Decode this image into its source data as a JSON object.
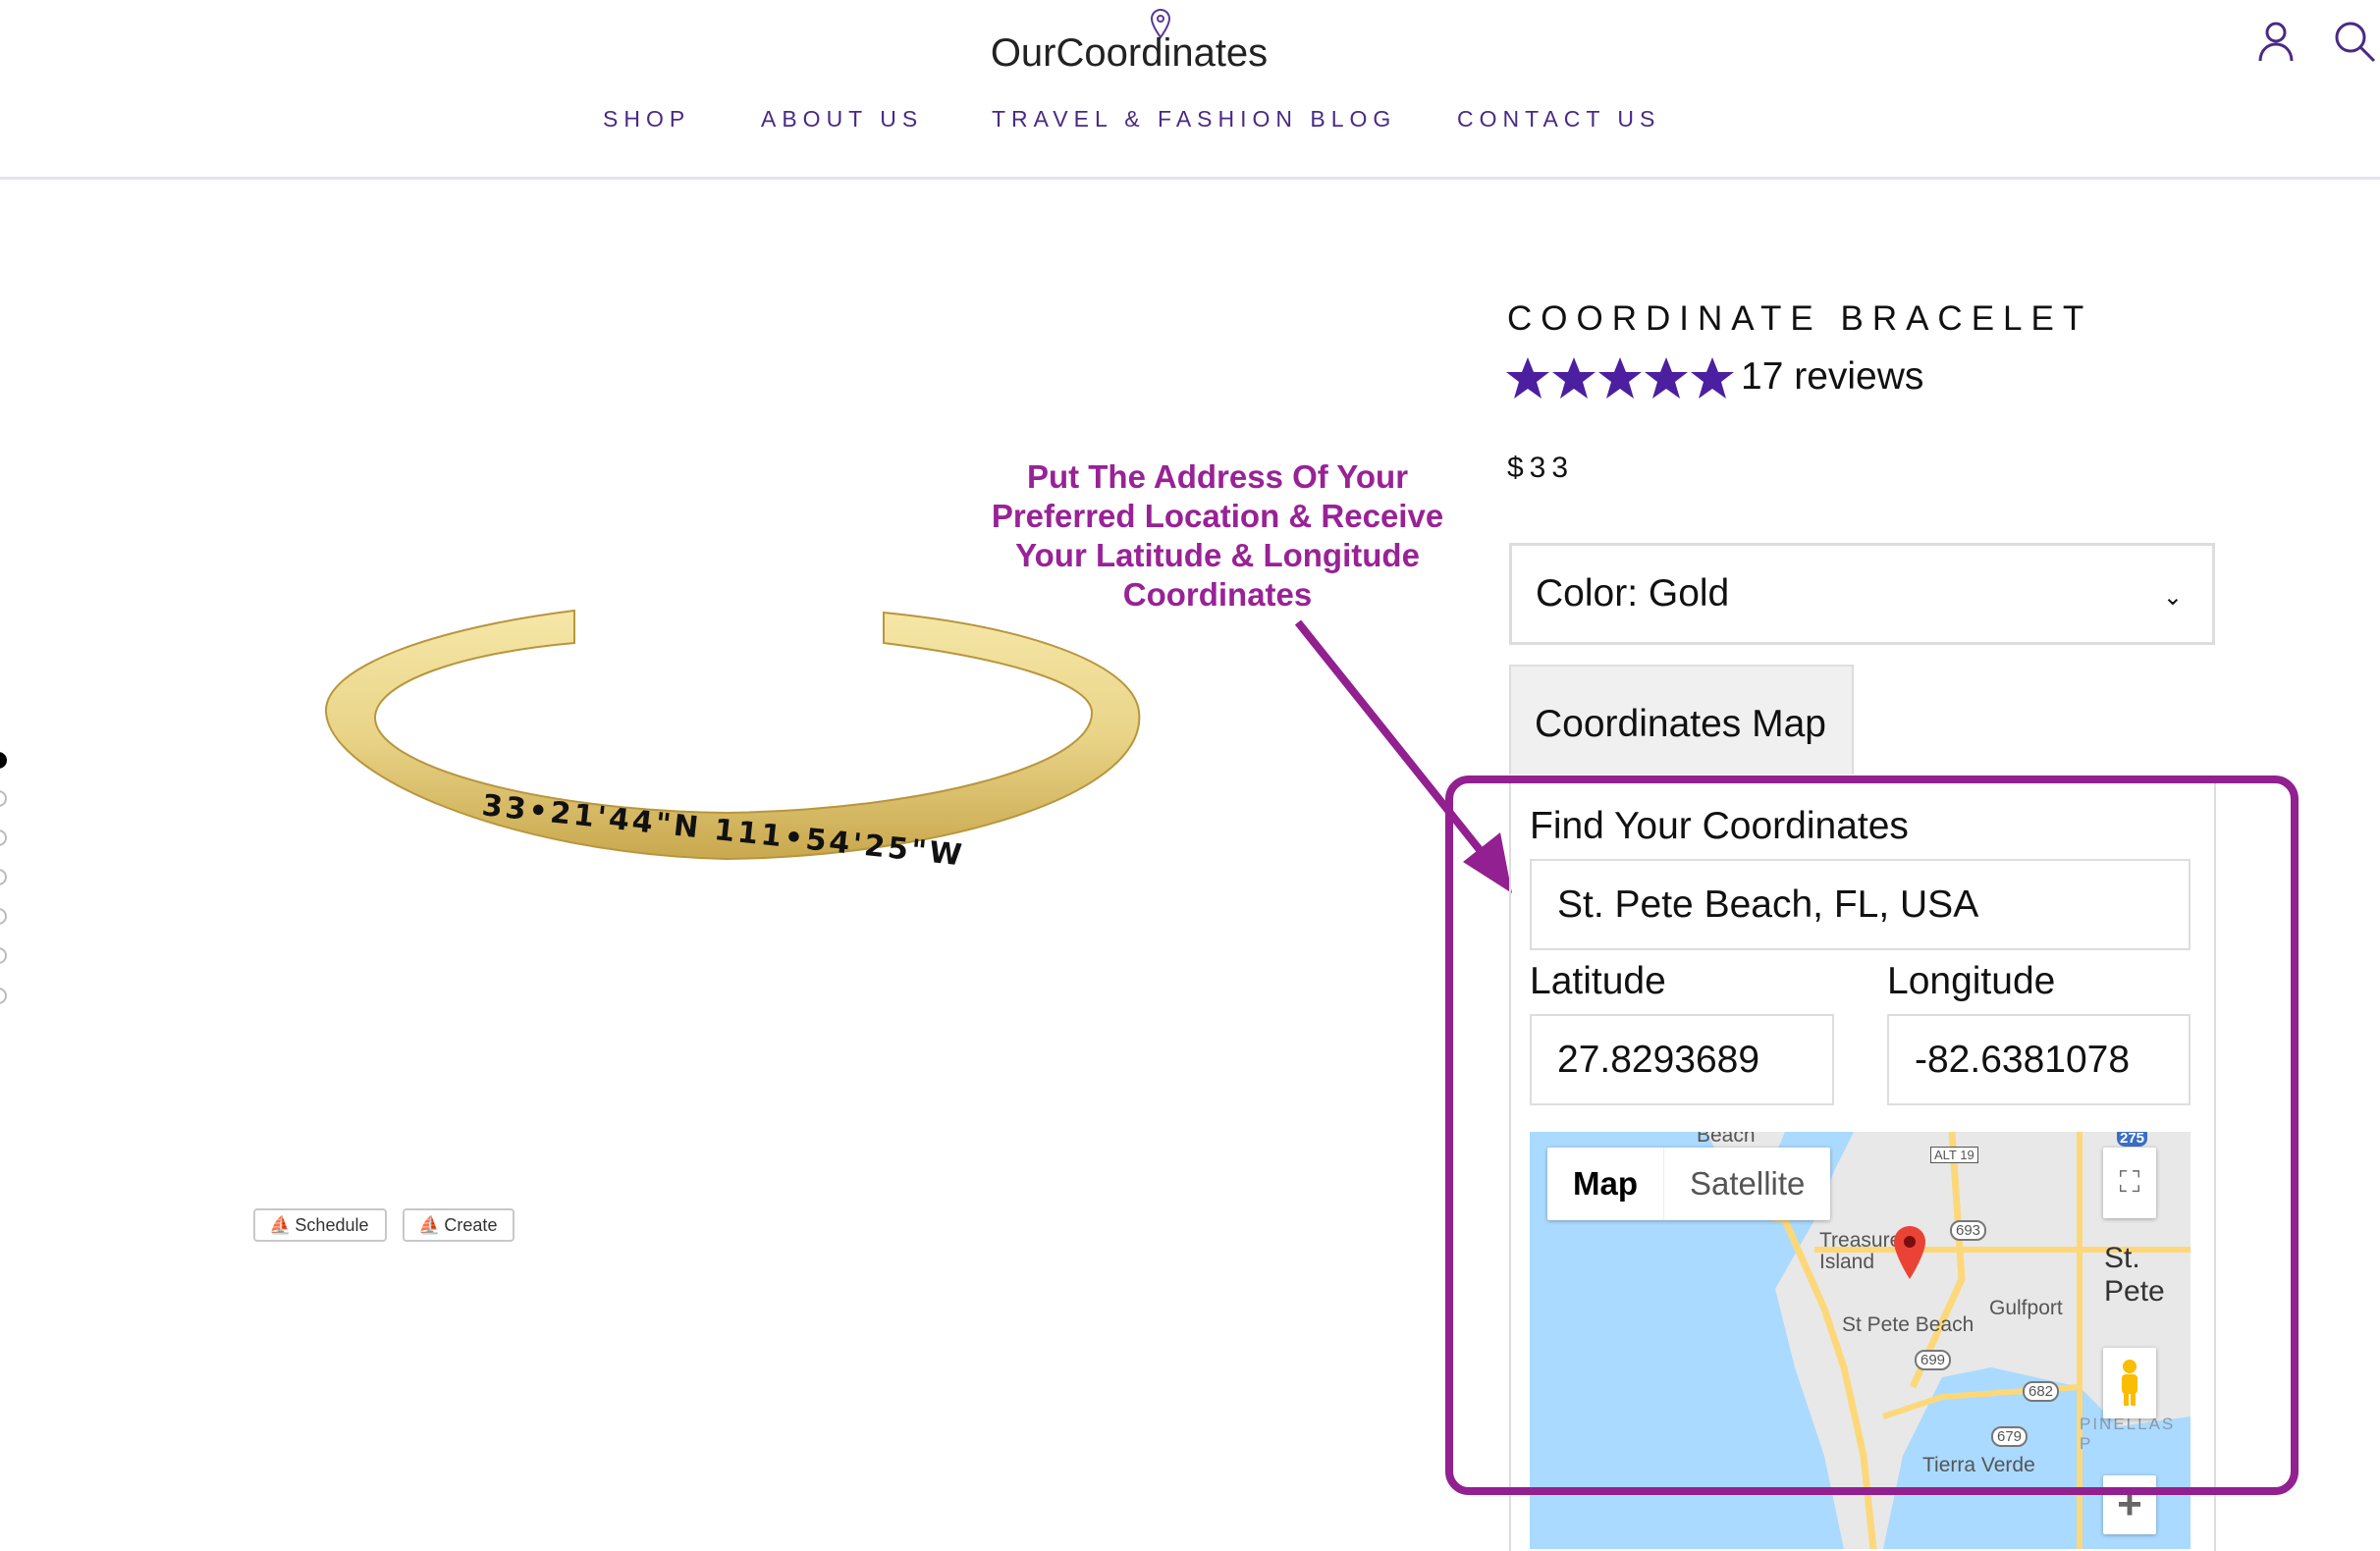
{
  "header": {
    "logo": "OurCoordinates",
    "nav": [
      "SHOP",
      "ABOUT US",
      "TRAVEL & FASHION BLOG",
      "CONTACT US"
    ],
    "icons": [
      "user-icon",
      "search-icon"
    ]
  },
  "gallery": {
    "active_index": 0,
    "count": 7,
    "bracelet_engraving": "33•21'44\"N 111•54'25\"W",
    "buttons": [
      "Schedule",
      "Create"
    ]
  },
  "annotation": {
    "lines": [
      "Put The Address Of Your",
      "Preferred Location & Receive",
      "Your Latitude & Longitude",
      "Coordinates"
    ],
    "color": "#982296"
  },
  "product": {
    "title": "COORDINATE BRACELET",
    "rating": 5,
    "reviews": "17 reviews",
    "price": "$33",
    "color_select": "Color: Gold",
    "tab": "Coordinates Map",
    "star_color": "#4b1fa0"
  },
  "finder": {
    "heading": "Find Your Coordinates",
    "address": "St. Pete Beach, FL, USA",
    "latitude_label": "Latitude",
    "longitude_label": "Longitude",
    "latitude": "27.8293689",
    "longitude": "-82.6381078"
  },
  "map": {
    "types": [
      "Map",
      "Satellite"
    ],
    "labels": [
      "Beach",
      "Treasure Island",
      "St. Pete",
      "Gulfport",
      "St Pete Beach",
      "Tierra Verde",
      "PINELLAS P"
    ],
    "shields": [
      "ALT 19",
      "693",
      "699",
      "682",
      "679",
      "275"
    ]
  },
  "highlight_color": "#922090"
}
